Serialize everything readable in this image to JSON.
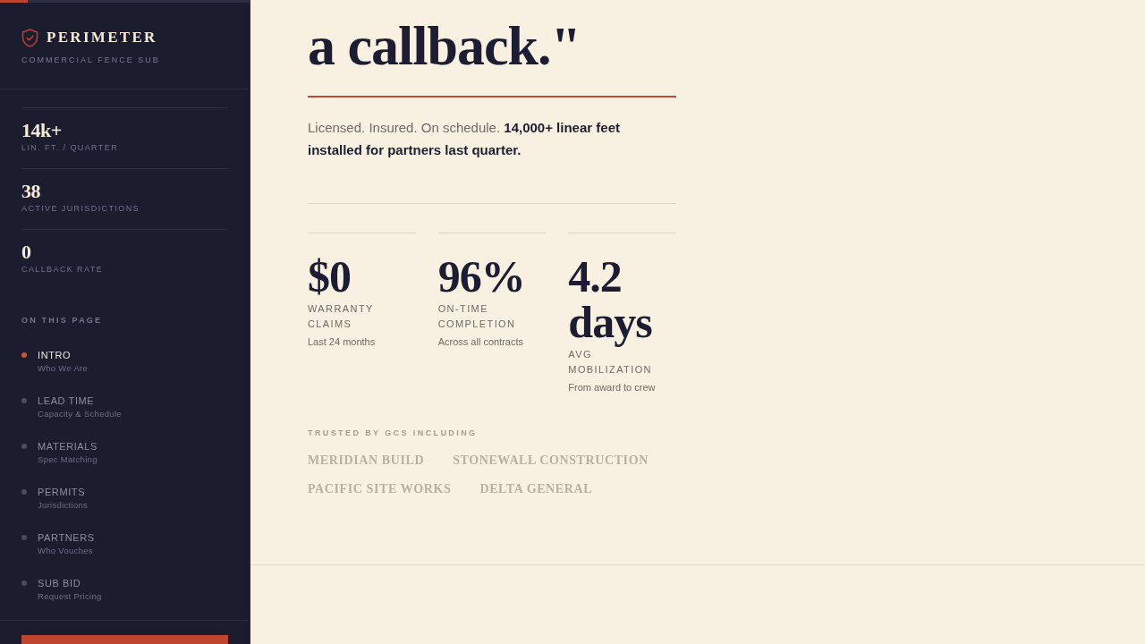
{
  "progress": {
    "level": 0.11
  },
  "brand": {
    "name": "PERIMETER",
    "tagline": "COMMERCIAL FENCE SUB"
  },
  "sidebar_stats": [
    {
      "value": "14k+",
      "label": "LIN. FT. / QUARTER"
    },
    {
      "value": "38",
      "label": "ACTIVE JURISDICTIONS"
    },
    {
      "value": "0",
      "label": "CALLBACK RATE"
    }
  ],
  "page_nav": {
    "heading": "ON THIS PAGE",
    "items": [
      {
        "label": "INTRO",
        "sublabel": "Who We Are",
        "selected": true
      },
      {
        "label": "LEAD TIME",
        "sublabel": "Capacity & Schedule",
        "selected": false
      },
      {
        "label": "MATERIALS",
        "sublabel": "Spec Matching",
        "selected": false
      },
      {
        "label": "PERMITS",
        "sublabel": "Jurisdictions",
        "selected": false
      },
      {
        "label": "PARTNERS",
        "sublabel": "Who Vouches",
        "selected": false
      },
      {
        "label": "SUB BID",
        "sublabel": "Request Pricing",
        "selected": false
      }
    ]
  },
  "hero": {
    "headline": "a callback.\"",
    "lead": "Licensed. Insured. On schedule. **14,000+ linear feet installed for partners last quarter.**"
  },
  "metrics": [
    {
      "value": "$0",
      "label": "WARRANTY CLAIMS",
      "note": "Last 24 months"
    },
    {
      "value": "96%",
      "label": "ON-TIME COMPLETION",
      "note": "Across all contracts"
    },
    {
      "value": "4.2 days",
      "label": "AVG MOBILIZATION",
      "note": "From award to crew"
    }
  ],
  "clients": {
    "heading": "TRUSTED BY GCS INCLUDING",
    "names": [
      "MERIDIAN BUILD",
      "STONEWALL CONSTRUCTION",
      "PACIFIC SITE WORKS",
      "DELTA GENERAL"
    ]
  }
}
